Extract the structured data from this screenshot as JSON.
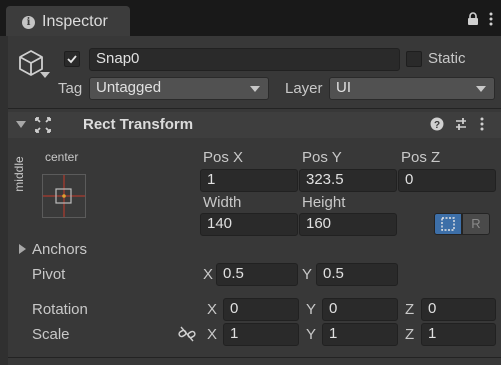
{
  "tab": {
    "title": "Inspector",
    "icon": "info-icon"
  },
  "tab_tools": [
    "lock-icon",
    "kebab-menu-icon"
  ],
  "object": {
    "icon": "cube-icon",
    "active": true,
    "name": "Snap0",
    "static_label": "Static",
    "static_checked": false,
    "tag_label": "Tag",
    "tag_value": "Untagged",
    "layer_label": "Layer",
    "layer_value": "UI"
  },
  "component": {
    "title": "Rect Transform",
    "icon": "rect-transform-icon",
    "header_tools": [
      "help-icon",
      "preset-sliders-icon",
      "kebab-menu-icon"
    ],
    "anchor_preset": {
      "horizontal": "center",
      "vertical": "middle"
    },
    "pos_x_label": "Pos X",
    "pos_x": "1",
    "pos_y_label": "Pos Y",
    "pos_y": "323.5",
    "pos_z_label": "Pos Z",
    "pos_z": "0",
    "width_label": "Width",
    "width": "140",
    "height_label": "Height",
    "height": "160",
    "blueprint_icon": "blueprint-mode-icon",
    "raw_edit_icon": "raw-edit-icon",
    "raw_edit_label": "R",
    "anchors_label": "Anchors",
    "pivot_label": "Pivot",
    "pivot_x_label": "X",
    "pivot_x": "0.5",
    "pivot_y_label": "Y",
    "pivot_y": "0.5",
    "rotation_label": "Rotation",
    "rot_x_label": "X",
    "rot_x": "0",
    "rot_y_label": "Y",
    "rot_y": "0",
    "rot_z_label": "Z",
    "rot_z": "0",
    "scale_label": "Scale",
    "scale_link_icon": "unlinked-chain-icon",
    "scale_x_label": "X",
    "scale_x": "1",
    "scale_y_label": "Y",
    "scale_y": "1",
    "scale_z_label": "Z",
    "scale_z": "1"
  },
  "colors": {
    "accent_blue": "#3d6fa8",
    "panel": "#383838",
    "field": "#2a2a2a",
    "anchor_red": "#c53a2a",
    "anchor_orange": "#e0a030"
  }
}
